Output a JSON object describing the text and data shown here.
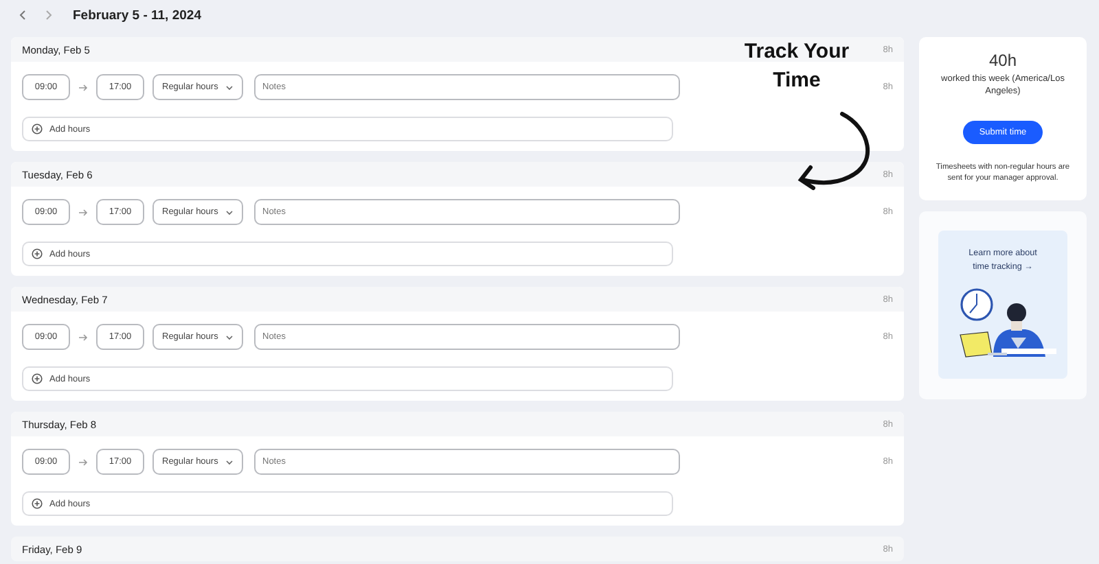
{
  "week": {
    "title": "February 5 - 11, 2024"
  },
  "days": [
    {
      "label": "Monday, Feb 5",
      "total": "8h",
      "entries": [
        {
          "start": "09:00",
          "end": "17:00",
          "type": "Regular hours",
          "notes_placeholder": "Notes",
          "hours": "8h"
        }
      ],
      "add_label": "Add hours"
    },
    {
      "label": "Tuesday, Feb 6",
      "total": "8h",
      "entries": [
        {
          "start": "09:00",
          "end": "17:00",
          "type": "Regular hours",
          "notes_placeholder": "Notes",
          "hours": "8h"
        }
      ],
      "add_label": "Add hours"
    },
    {
      "label": "Wednesday, Feb 7",
      "total": "8h",
      "entries": [
        {
          "start": "09:00",
          "end": "17:00",
          "type": "Regular hours",
          "notes_placeholder": "Notes",
          "hours": "8h"
        }
      ],
      "add_label": "Add hours"
    },
    {
      "label": "Thursday, Feb 8",
      "total": "8h",
      "entries": [
        {
          "start": "09:00",
          "end": "17:00",
          "type": "Regular hours",
          "notes_placeholder": "Notes",
          "hours": "8h"
        }
      ],
      "add_label": "Add hours"
    },
    {
      "label": "Friday, Feb 9",
      "total": "8h"
    }
  ],
  "summary": {
    "hours": "40h",
    "caption": "worked this week (America/Los Angeles)",
    "button": "Submit time",
    "note": "Timesheets with non-regular hours are sent for your manager approval."
  },
  "promo": {
    "link": "Learn more about time tracking →"
  },
  "annotation": {
    "text": "Track Your Time"
  }
}
